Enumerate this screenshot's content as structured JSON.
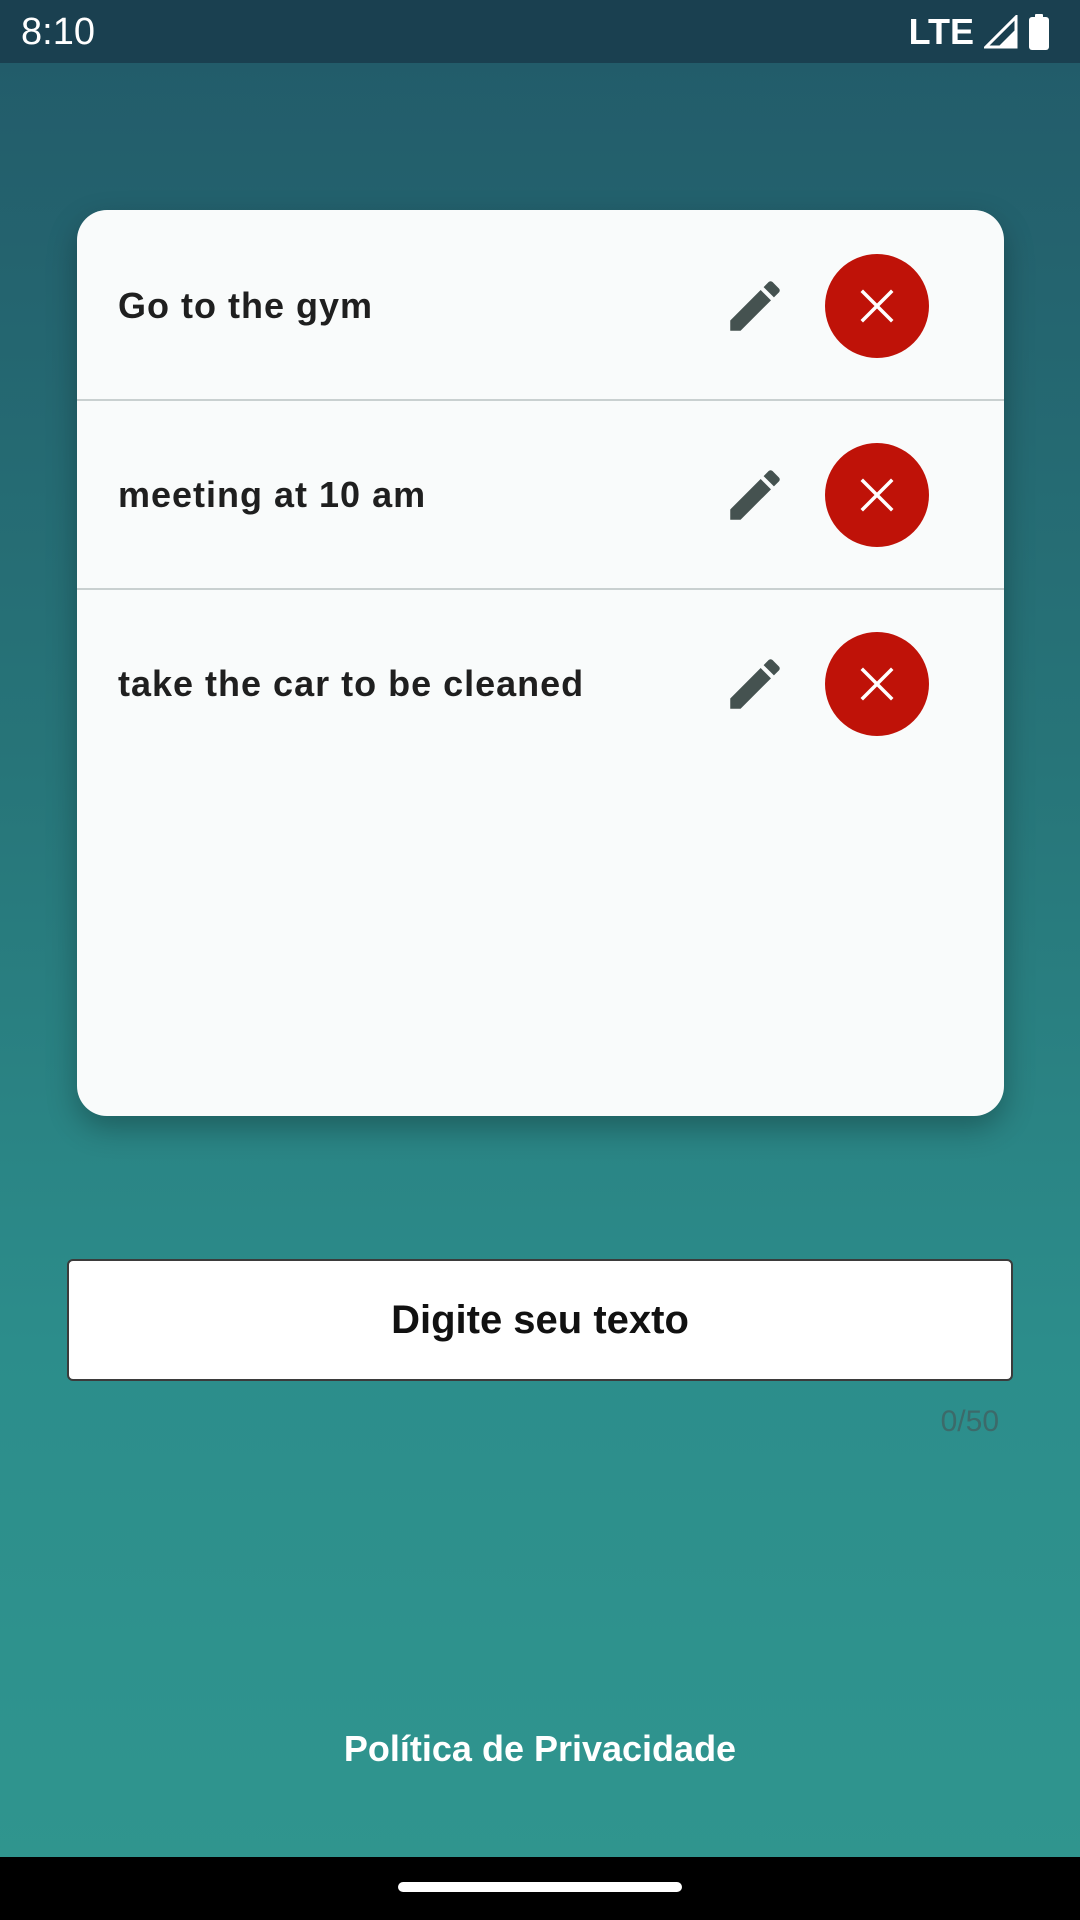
{
  "status_bar": {
    "time": "8:10",
    "network": "LTE",
    "signal_icon": "signal-icon",
    "battery_icon": "battery-icon"
  },
  "todos": [
    {
      "text": "Go to the gym",
      "edit_icon": "pencil-icon",
      "delete_icon": "close-icon"
    },
    {
      "text": "meeting at 10 am",
      "edit_icon": "pencil-icon",
      "delete_icon": "close-icon"
    },
    {
      "text": "take the car to be cleaned",
      "edit_icon": "pencil-icon",
      "delete_icon": "close-icon"
    }
  ],
  "input": {
    "placeholder": "Digite seu texto",
    "value": "",
    "counter": "0/50"
  },
  "footer": {
    "privacy_link": "Política de Privacidade"
  },
  "colors": {
    "delete_button": "#bf1208",
    "edit_icon": "#455250",
    "background_top": "#225a69",
    "background_bottom": "#30968f",
    "status_bar": "#1a4050"
  }
}
